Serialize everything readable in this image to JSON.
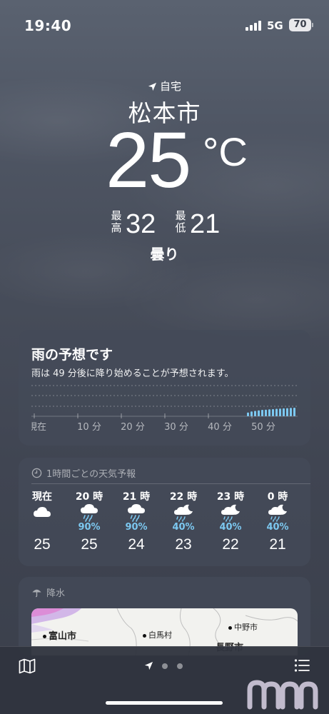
{
  "status_bar": {
    "time": "19:40",
    "network": "5G",
    "battery": "70"
  },
  "location": {
    "label": "自宅",
    "city": "松本市",
    "temperature": "25",
    "unit": "°C",
    "high_label_1": "最",
    "high_label_2": "高",
    "high_value": "32",
    "low_label_1": "最",
    "low_label_2": "低",
    "low_value": "21",
    "condition": "曇り"
  },
  "rain_forecast": {
    "title": "雨の予想です",
    "description": "雨は 49 分後に降り始めることが予想されます。",
    "axis_labels": [
      "現在",
      "10 分",
      "20 分",
      "30 分",
      "40 分",
      "50 分"
    ],
    "intensity_bars": [
      0.35,
      0.45,
      0.5,
      0.55,
      0.6,
      0.62,
      0.65,
      0.67,
      0.7,
      0.72,
      0.74,
      0.76,
      0.78,
      0.8
    ]
  },
  "hourly": {
    "header": "1時間ごとの天気予報",
    "items": [
      {
        "time": "現在",
        "icon": "cloud-icon",
        "pop": "",
        "temp": "25"
      },
      {
        "time": "20 時",
        "icon": "rain-cloud-icon",
        "pop": "90%",
        "temp": "25"
      },
      {
        "time": "21 時",
        "icon": "rain-cloud-icon",
        "pop": "90%",
        "temp": "24"
      },
      {
        "time": "22 時",
        "icon": "moon-rain-icon",
        "pop": "40%",
        "temp": "23"
      },
      {
        "time": "23 時",
        "icon": "moon-rain-icon",
        "pop": "40%",
        "temp": "22"
      },
      {
        "time": "0 時",
        "icon": "moon-rain-icon",
        "pop": "40%",
        "temp": "21"
      }
    ]
  },
  "precipitation": {
    "header": "降水",
    "map_places": [
      "富山市",
      "白馬村",
      "中野市",
      "長野市"
    ]
  },
  "colors": {
    "accent_rain": "#7cc8f0",
    "card_bg": "#444a58"
  },
  "icons": {
    "location": "location-arrow-icon",
    "clock": "clock-icon",
    "umbrella": "umbrella-icon",
    "map": "map-icon",
    "list": "list-icon"
  }
}
